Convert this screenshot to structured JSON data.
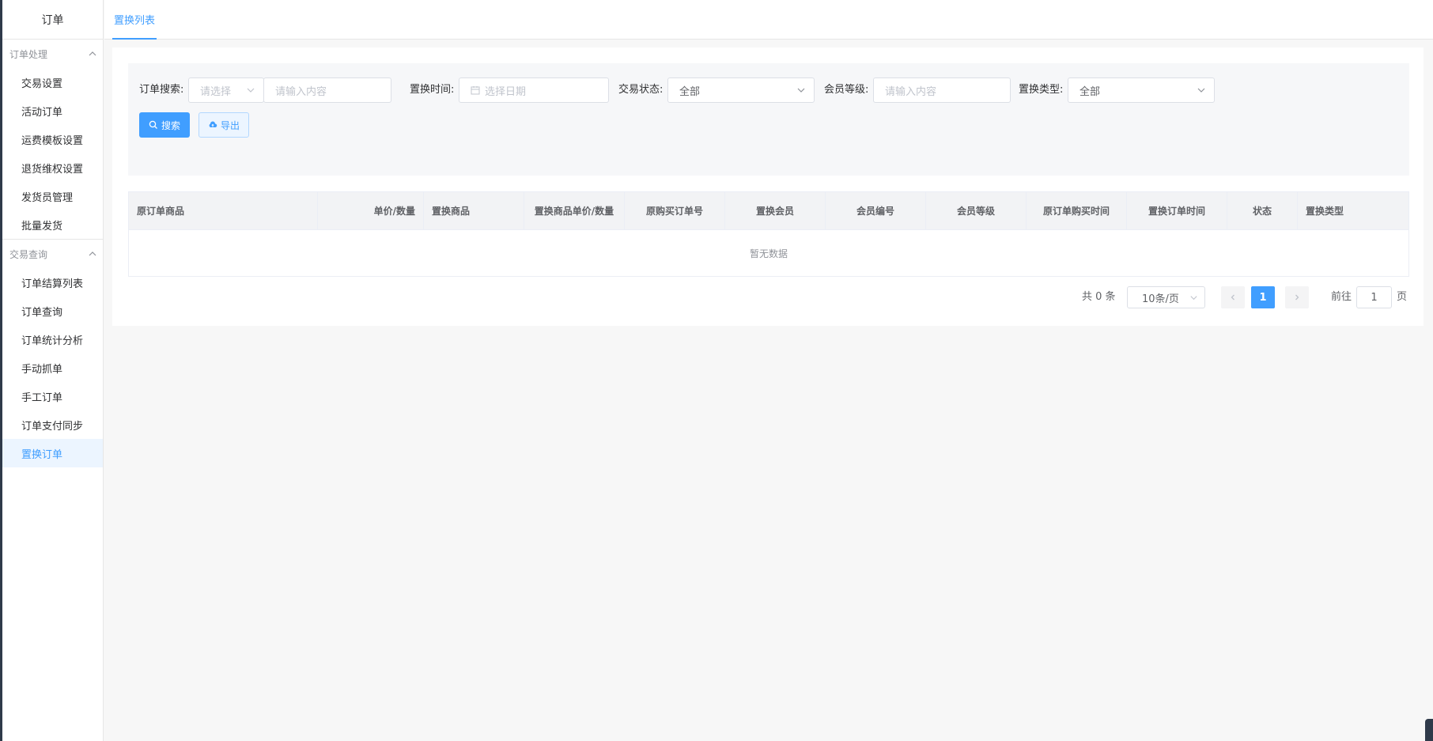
{
  "sidebar": {
    "title": "订单",
    "groups": [
      {
        "label": "订单处理",
        "items": [
          "交易设置",
          "活动订单",
          "运费模板设置",
          "退货维权设置",
          "发货员管理",
          "批量发货"
        ]
      },
      {
        "label": "交易查询",
        "items": [
          "订单结算列表",
          "订单查询",
          "订单统计分析",
          "手动抓单",
          "手工订单",
          "订单支付同步",
          "置换订单"
        ]
      }
    ],
    "active_item": "置换订单"
  },
  "topbar": {
    "tab_label": "置换列表"
  },
  "filters": {
    "order_search_label": "订单搜索:",
    "order_search_select_placeholder": "请选择",
    "order_search_input_placeholder": "请输入内容",
    "swap_time_label": "置换时间:",
    "swap_time_placeholder": "选择日期",
    "trade_status_label": "交易状态:",
    "trade_status_value": "全部",
    "member_level_label": "会员等级:",
    "member_level_placeholder": "请输入内容",
    "swap_type_label": "置换类型:",
    "swap_type_value": "全部"
  },
  "actions": {
    "search_label": "搜索",
    "export_label": "导出"
  },
  "table": {
    "columns": [
      "原订单商品",
      "单价/数量",
      "置换商品",
      "置换商品单价/数量",
      "原购买订单号",
      "置换会员",
      "会员编号",
      "会员等级",
      "原订单购买时间",
      "置换订单时间",
      "状态",
      "置换类型"
    ],
    "empty_text": "暂无数据"
  },
  "pagination": {
    "total_text": "共 0 条",
    "page_size": "10条/页",
    "current_page": "1",
    "goto_prefix": "前往",
    "goto_value": "1",
    "goto_suffix": "页"
  },
  "colors": {
    "primary": "#409eff",
    "sidebar_active_bg": "#ecf5ff"
  },
  "icons": [
    "chevron-up-icon",
    "chevron-down-icon",
    "calendar-icon",
    "search-icon",
    "cloud-upload-icon",
    "chevron-left-icon",
    "chevron-right-icon"
  ]
}
